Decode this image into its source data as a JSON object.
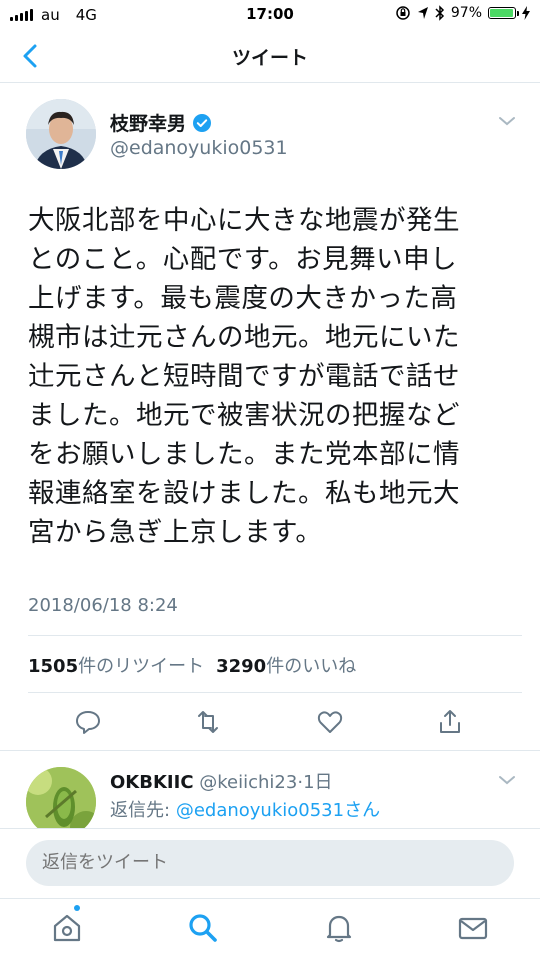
{
  "status_bar": {
    "carrier": "au",
    "network": "4G",
    "time": "17:00",
    "battery": "97%",
    "battery_level": 0.97
  },
  "nav": {
    "title": "ツイート"
  },
  "tweet": {
    "author_name": "枝野幸男",
    "author_handle": "@edanoyukio0531",
    "text_lines": [
      "大阪北部を中心に大きな地震が発生",
      "とのこと。心配です。お見舞い申し",
      "上げます。最も震度の大きかった高",
      "槻市は辻元さんの地元。地元にいた",
      "辻元さんと短時間ですが電話で話せ",
      "ました。地元で被害状況の把握など",
      "をお願いしました。また党本部に情",
      "報連絡室を設けました。私も地元大",
      "宮から急ぎ上京します。"
    ],
    "timestamp": "2018/06/18 8:24",
    "retweets_count": "1505",
    "retweets_label": "件のリツイート",
    "likes_count": "3290",
    "likes_label": "件のいいね"
  },
  "reply": {
    "name": "OKBKIIC",
    "handle": "@keiichi23",
    "separator": "·",
    "age": "1日",
    "reply_to_label": "返信先:",
    "reply_to_mention": "@edanoyukio0531さん"
  },
  "composer": {
    "placeholder": "返信をツイート"
  },
  "colors": {
    "accent": "#1da1f2",
    "text": "#14171a",
    "secondary": "#657786",
    "divider": "#e1e8ed"
  },
  "icons": {
    "actions": [
      "reply-icon",
      "retweet-icon",
      "like-icon",
      "share-icon"
    ],
    "tabs": [
      "home-icon",
      "search-icon",
      "notifications-icon",
      "messages-icon"
    ]
  }
}
